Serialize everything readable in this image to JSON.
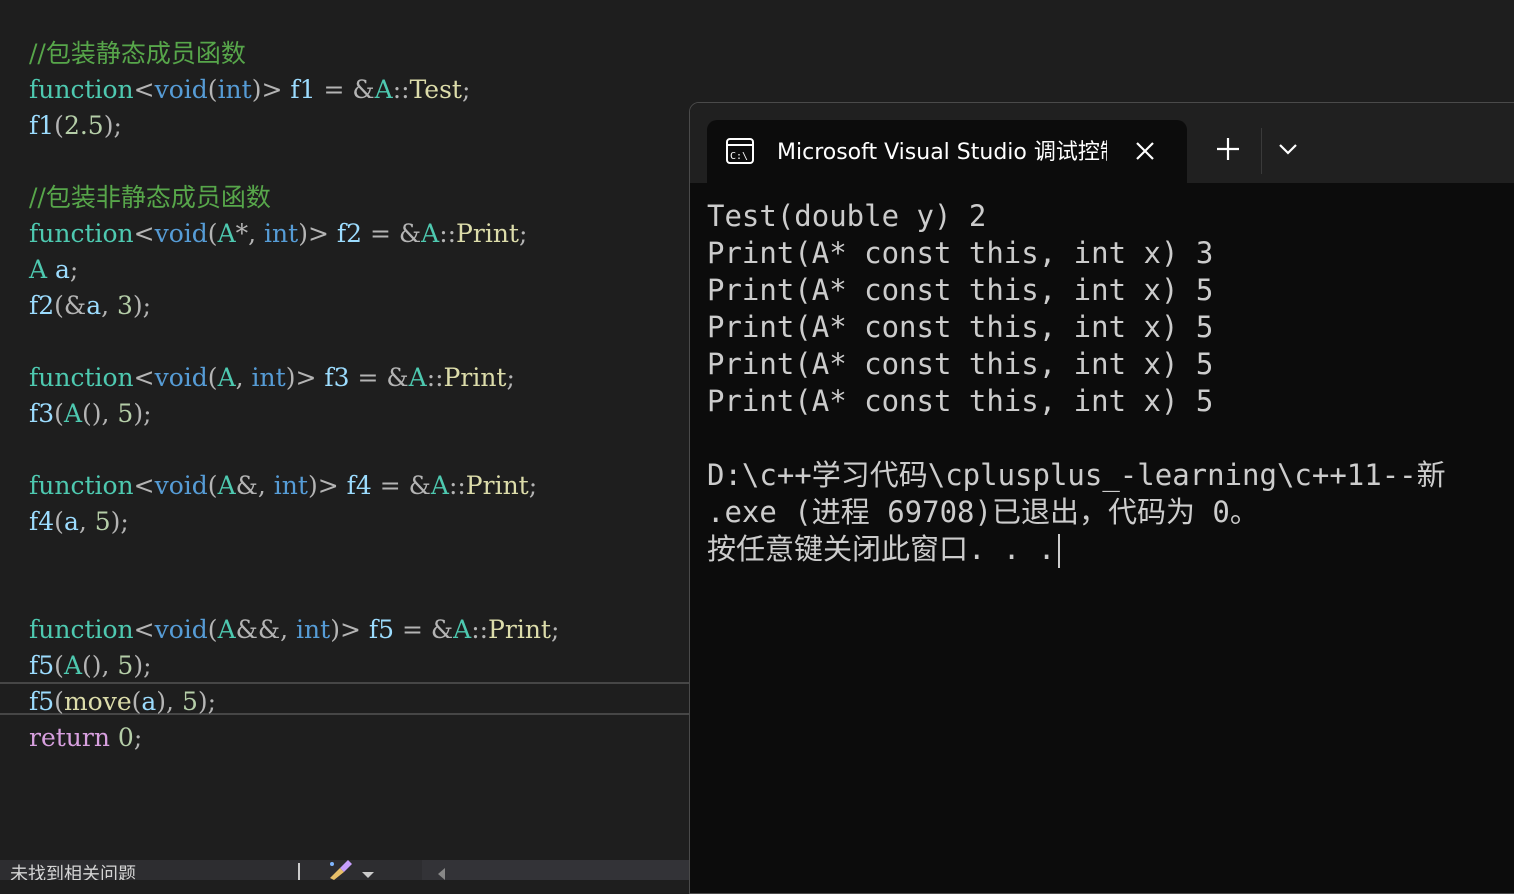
{
  "editor": {
    "lines": [
      [
        {
          "t": "//包装静态成员函数",
          "c": "comment"
        }
      ],
      [
        {
          "t": "function",
          "c": "type"
        },
        {
          "t": "<",
          "c": "op"
        },
        {
          "t": "void",
          "c": "kw"
        },
        {
          "t": "(",
          "c": "op"
        },
        {
          "t": "int",
          "c": "kw"
        },
        {
          "t": ")> ",
          "c": "op"
        },
        {
          "t": "f1",
          "c": "var"
        },
        {
          "t": " = ",
          "c": "op"
        },
        {
          "t": "&",
          "c": "op"
        },
        {
          "t": "A",
          "c": "type"
        },
        {
          "t": "::",
          "c": "op"
        },
        {
          "t": "Test",
          "c": "func"
        },
        {
          "t": ";",
          "c": "op"
        }
      ],
      [
        {
          "t": "f1",
          "c": "var"
        },
        {
          "t": "(",
          "c": "op"
        },
        {
          "t": "2.5",
          "c": "num"
        },
        {
          "t": ");",
          "c": "op"
        }
      ],
      [],
      [
        {
          "t": "//包装非静态成员函数",
          "c": "comment"
        }
      ],
      [
        {
          "t": "function",
          "c": "type"
        },
        {
          "t": "<",
          "c": "op"
        },
        {
          "t": "void",
          "c": "kw"
        },
        {
          "t": "(",
          "c": "op"
        },
        {
          "t": "A",
          "c": "type"
        },
        {
          "t": "*, ",
          "c": "op"
        },
        {
          "t": "int",
          "c": "kw"
        },
        {
          "t": ")> ",
          "c": "op"
        },
        {
          "t": "f2",
          "c": "var"
        },
        {
          "t": " = ",
          "c": "op"
        },
        {
          "t": "&",
          "c": "op"
        },
        {
          "t": "A",
          "c": "type"
        },
        {
          "t": "::",
          "c": "op"
        },
        {
          "t": "Print",
          "c": "func"
        },
        {
          "t": ";",
          "c": "op"
        }
      ],
      [
        {
          "t": "A",
          "c": "type"
        },
        {
          "t": " ",
          "c": "plain"
        },
        {
          "t": "a",
          "c": "var"
        },
        {
          "t": ";",
          "c": "op"
        }
      ],
      [
        {
          "t": "f2",
          "c": "var"
        },
        {
          "t": "(&",
          "c": "op"
        },
        {
          "t": "a",
          "c": "var"
        },
        {
          "t": ", ",
          "c": "op"
        },
        {
          "t": "3",
          "c": "num"
        },
        {
          "t": ");",
          "c": "op"
        }
      ],
      [],
      [
        {
          "t": "function",
          "c": "type"
        },
        {
          "t": "<",
          "c": "op"
        },
        {
          "t": "void",
          "c": "kw"
        },
        {
          "t": "(",
          "c": "op"
        },
        {
          "t": "A",
          "c": "type"
        },
        {
          "t": ", ",
          "c": "op"
        },
        {
          "t": "int",
          "c": "kw"
        },
        {
          "t": ")> ",
          "c": "op"
        },
        {
          "t": "f3",
          "c": "var"
        },
        {
          "t": " = ",
          "c": "op"
        },
        {
          "t": "&",
          "c": "op"
        },
        {
          "t": "A",
          "c": "type"
        },
        {
          "t": "::",
          "c": "op"
        },
        {
          "t": "Print",
          "c": "func"
        },
        {
          "t": ";",
          "c": "op"
        }
      ],
      [
        {
          "t": "f3",
          "c": "var"
        },
        {
          "t": "(",
          "c": "op"
        },
        {
          "t": "A",
          "c": "type"
        },
        {
          "t": "(), ",
          "c": "op"
        },
        {
          "t": "5",
          "c": "num"
        },
        {
          "t": ");",
          "c": "op"
        }
      ],
      [],
      [
        {
          "t": "function",
          "c": "type"
        },
        {
          "t": "<",
          "c": "op"
        },
        {
          "t": "void",
          "c": "kw"
        },
        {
          "t": "(",
          "c": "op"
        },
        {
          "t": "A",
          "c": "type"
        },
        {
          "t": "&, ",
          "c": "op"
        },
        {
          "t": "int",
          "c": "kw"
        },
        {
          "t": ")> ",
          "c": "op"
        },
        {
          "t": "f4",
          "c": "var"
        },
        {
          "t": " = ",
          "c": "op"
        },
        {
          "t": "&",
          "c": "op"
        },
        {
          "t": "A",
          "c": "type"
        },
        {
          "t": "::",
          "c": "op"
        },
        {
          "t": "Print",
          "c": "func"
        },
        {
          "t": ";",
          "c": "op"
        }
      ],
      [
        {
          "t": "f4",
          "c": "var"
        },
        {
          "t": "(",
          "c": "op"
        },
        {
          "t": "a",
          "c": "var"
        },
        {
          "t": ", ",
          "c": "op"
        },
        {
          "t": "5",
          "c": "num"
        },
        {
          "t": ");",
          "c": "op"
        }
      ],
      [],
      [],
      [
        {
          "t": "function",
          "c": "type"
        },
        {
          "t": "<",
          "c": "op"
        },
        {
          "t": "void",
          "c": "kw"
        },
        {
          "t": "(",
          "c": "op"
        },
        {
          "t": "A",
          "c": "type"
        },
        {
          "t": "&&, ",
          "c": "op"
        },
        {
          "t": "int",
          "c": "kw"
        },
        {
          "t": ")> ",
          "c": "op"
        },
        {
          "t": "f5",
          "c": "var"
        },
        {
          "t": " = ",
          "c": "op"
        },
        {
          "t": "&",
          "c": "op"
        },
        {
          "t": "A",
          "c": "type"
        },
        {
          "t": "::",
          "c": "op"
        },
        {
          "t": "Print",
          "c": "func"
        },
        {
          "t": ";",
          "c": "op"
        }
      ],
      [
        {
          "t": "f5",
          "c": "var"
        },
        {
          "t": "(",
          "c": "op"
        },
        {
          "t": "A",
          "c": "type"
        },
        {
          "t": "(), ",
          "c": "op"
        },
        {
          "t": "5",
          "c": "num"
        },
        {
          "t": ");",
          "c": "op"
        }
      ],
      [
        {
          "t": "f5",
          "c": "var"
        },
        {
          "t": "(",
          "c": "op"
        },
        {
          "t": "move",
          "c": "func"
        },
        {
          "t": "(",
          "c": "op"
        },
        {
          "t": "a",
          "c": "var"
        },
        {
          "t": "), ",
          "c": "op"
        },
        {
          "t": "5",
          "c": "num"
        },
        {
          "t": ");",
          "c": "op"
        }
      ],
      [
        {
          "t": "return",
          "c": "ctrl"
        },
        {
          "t": " ",
          "c": "plain"
        },
        {
          "t": "0",
          "c": "num"
        },
        {
          "t": ";",
          "c": "op"
        }
      ]
    ],
    "status_text": "未找到相关问题"
  },
  "terminal": {
    "tab_title": "Microsoft Visual Studio 调试控制台",
    "icons": {
      "tab": "console-icon",
      "close": "close-icon",
      "new_tab": "plus-icon",
      "dropdown": "chevron-down-icon"
    },
    "output": [
      "Test(double y) 2",
      "Print(A* const this, int x) 3",
      "Print(A* const this, int x) 5",
      "Print(A* const this, int x) 5",
      "Print(A* const this, int x) 5",
      "Print(A* const this, int x) 5",
      "",
      "D:\\c++学习代码\\cplusplus_-learning\\c++11--新",
      ".exe (进程 69708)已退出，代码为 0。",
      "按任意键关闭此窗口. . ."
    ]
  },
  "colors": {
    "editor_bg": "#1e1e1e",
    "comment": "#57a64a",
    "type": "#4ec9b0",
    "keyword": "#569cd6",
    "terminal_bg": "#0c0c0c",
    "terminal_text": "#cccccc"
  }
}
